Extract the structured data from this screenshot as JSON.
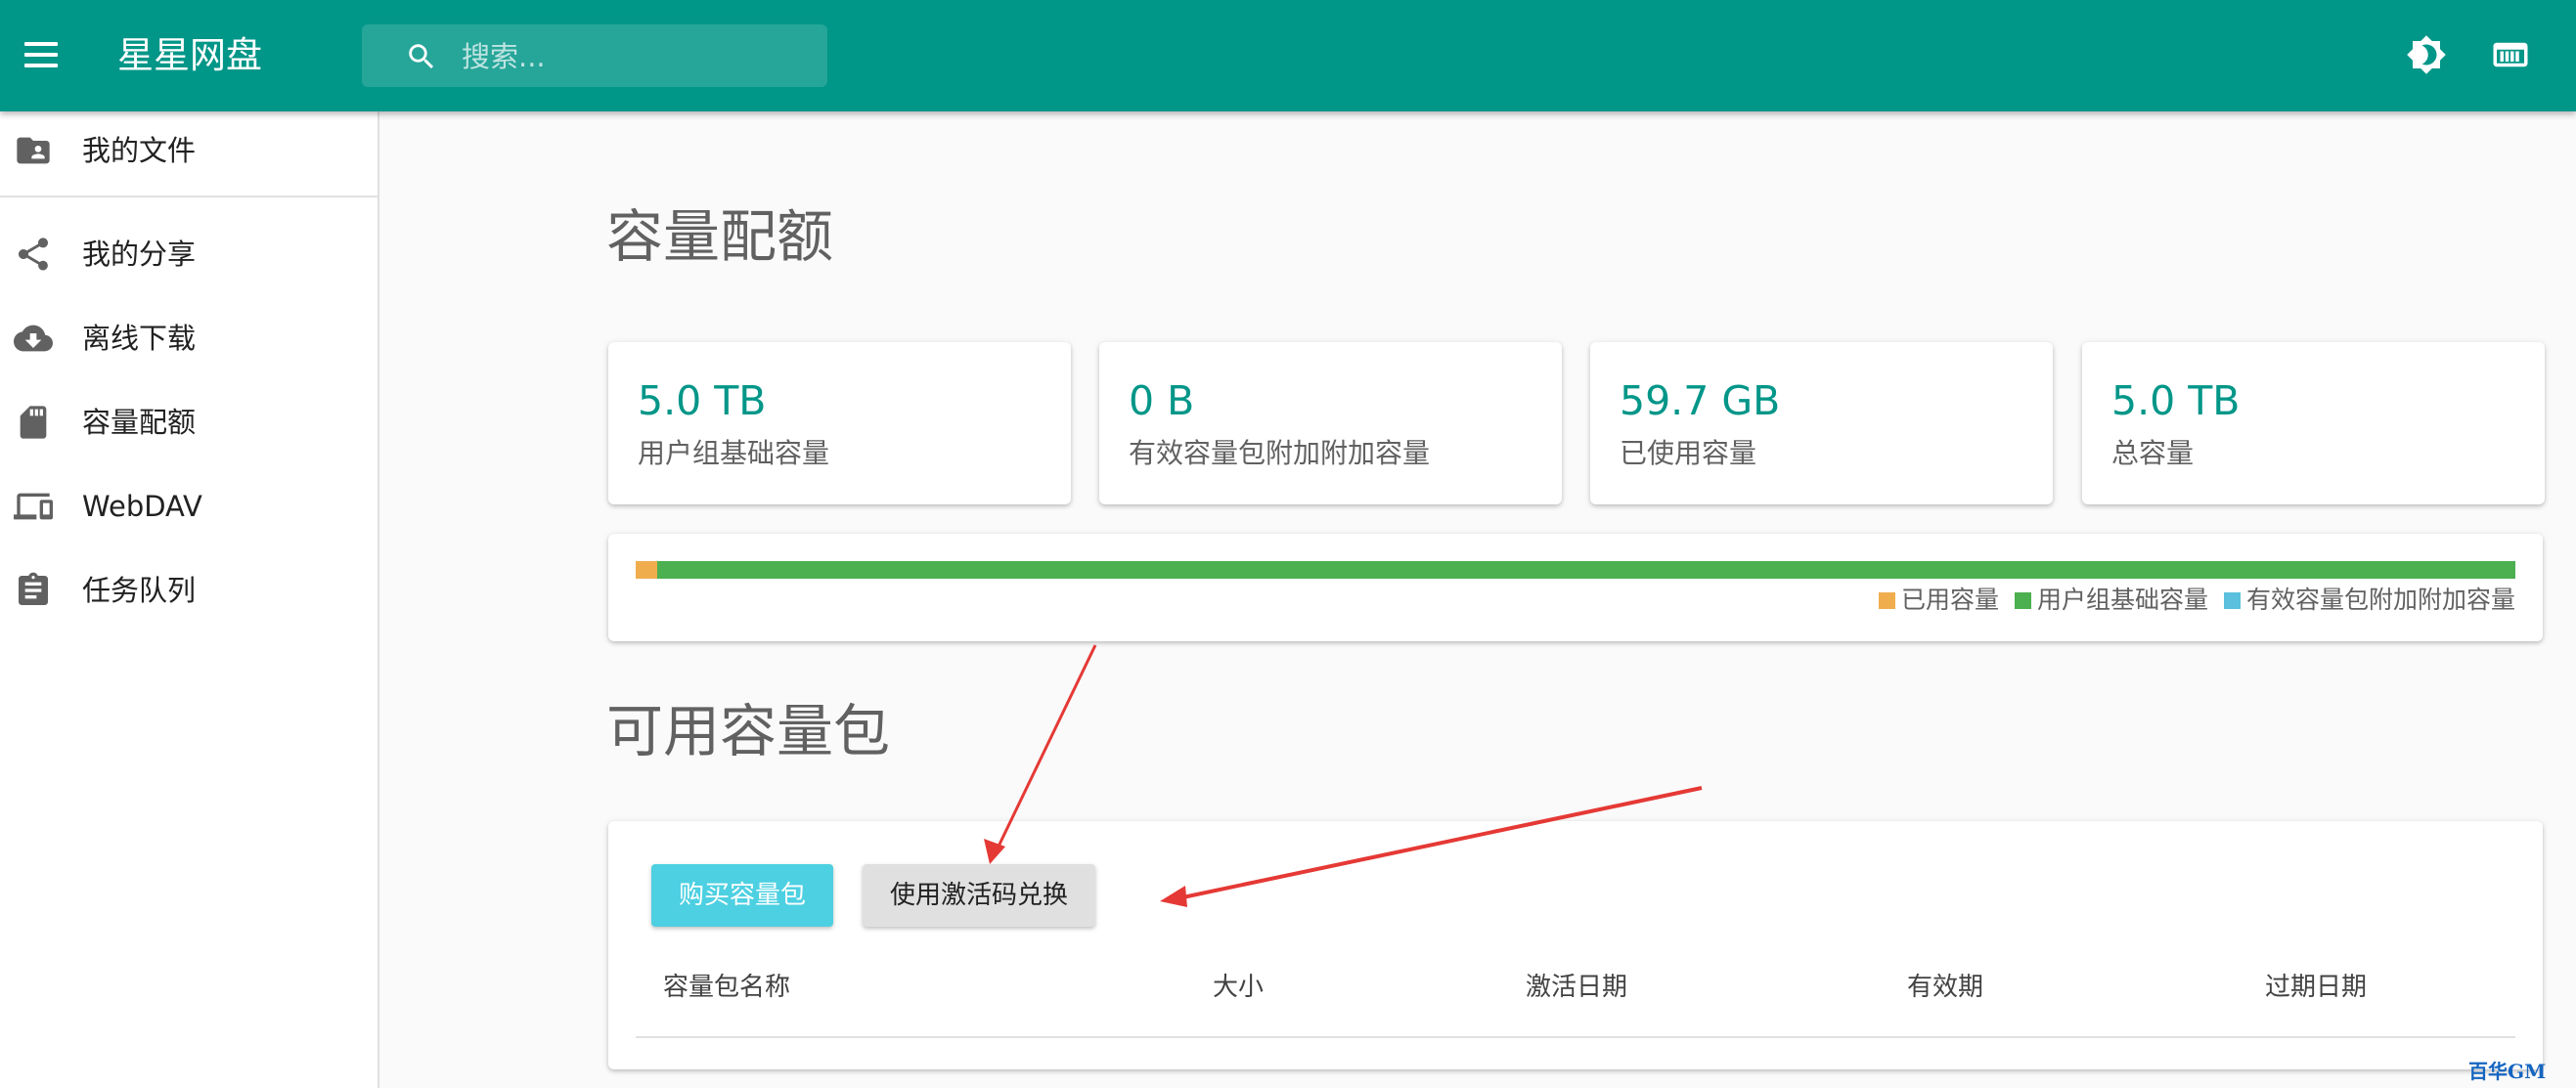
{
  "appbar": {
    "app_title": "星星网盘",
    "search_placeholder": "搜索...",
    "icons": [
      "menu-icon",
      "search-icon",
      "brightness-icon",
      "keyboard-icon"
    ]
  },
  "sidebar": {
    "items": [
      {
        "label": "我的文件",
        "icon": "folder-shared-icon"
      },
      {
        "label": "我的分享",
        "icon": "share-icon"
      },
      {
        "label": "离线下载",
        "icon": "cloud-download-icon"
      },
      {
        "label": "容量配额",
        "icon": "sd-card-icon"
      },
      {
        "label": "WebDAV",
        "icon": "devices-icon"
      },
      {
        "label": "任务队列",
        "icon": "assignment-icon"
      }
    ]
  },
  "main": {
    "quota_heading": "容量配额",
    "stats": [
      {
        "value": "5.0 TB",
        "label": "用户组基础容量"
      },
      {
        "value": "0 B",
        "label": "有效容量包附加附加容量"
      },
      {
        "value": "59.7 GB",
        "label": "已使用容量"
      },
      {
        "value": "5.0 TB",
        "label": "总容量"
      }
    ],
    "usage_bar": {
      "used_fraction": 0.0117,
      "base_fraction": 0.9883,
      "pack_fraction": 0,
      "colors": {
        "used": "#f0ad4e",
        "base": "#4caf50",
        "pack": "#5bc0de"
      },
      "legend": [
        "已用容量",
        "用户组基础容量",
        "有效容量包附加附加容量"
      ]
    },
    "packs_heading": "可用容量包",
    "buy_button": "购买容量包",
    "redeem_button": "使用激活码兑换",
    "table_headers": [
      "容量包名称",
      "大小",
      "激活日期",
      "有效期",
      "过期日期"
    ]
  },
  "watermark": "百华GM",
  "colors": {
    "primary": "#009688",
    "accent": "#4dd0e1",
    "annotation_arrow": "#e53935"
  }
}
